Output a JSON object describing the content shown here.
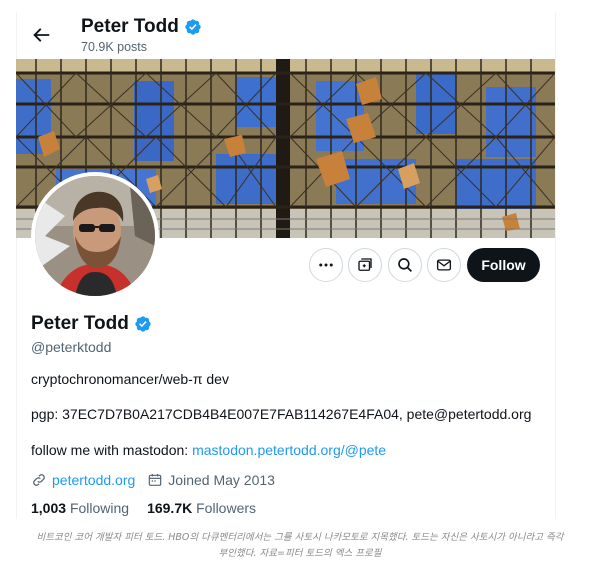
{
  "header": {
    "name": "Peter Todd",
    "posts": "70.9K posts"
  },
  "profile": {
    "name": "Peter Todd",
    "handle": "@peterktodd",
    "bio_line1": "cryptochronomancer/web-π dev",
    "bio_line2": "pgp: 37EC7D7B0A217CDB4B4E007E7FAB114267E4FA04, pete@petertodd.org",
    "bio_line3_prefix": "follow me with mastodon: ",
    "mastodon_link": "mastodon.petertodd.org/@pete",
    "website": "petertodd.org",
    "joined": "Joined May 2013",
    "following_count": "1,003",
    "following_label": "Following",
    "followers_count": "169.7K",
    "followers_label": "Followers"
  },
  "actions": {
    "follow_label": "Follow"
  },
  "icons": [
    "back-arrow-icon",
    "verified-badge-icon",
    "more-icon",
    "subscribe-icon",
    "search-icon",
    "message-icon",
    "link-icon",
    "calendar-icon"
  ],
  "colors": {
    "verified": "#1d9bf0",
    "link": "#1d9bf0",
    "follow_bg": "#0f1419",
    "muted": "#536471"
  },
  "caption": {
    "line1": "비트코인 코어 개발자 피터 토드. HBO의 다큐멘터리에서는 그를 사토시 나카모토로 지목했다. 토드는 자신은 사토시가 아니라고 즉각",
    "line2": "부인했다. 자료=피터 토드의 엑스 프로필"
  }
}
